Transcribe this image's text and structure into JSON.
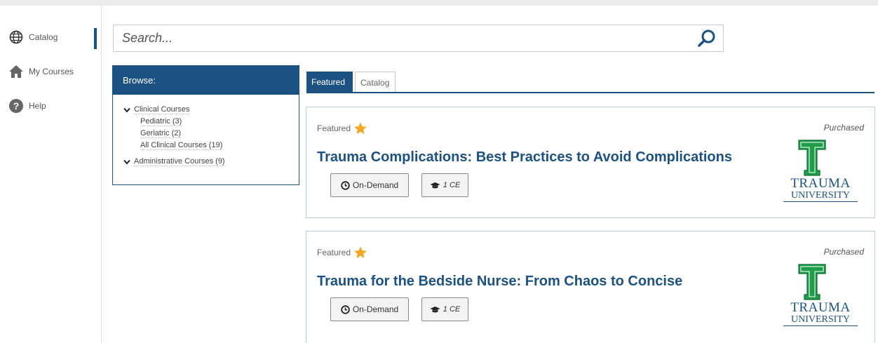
{
  "sidebar": {
    "items": [
      {
        "label": "Catalog",
        "icon": "globe-icon",
        "active": true
      },
      {
        "label": "My Courses",
        "icon": "home-icon",
        "active": false
      },
      {
        "label": "Help",
        "icon": "help-icon",
        "active": false
      }
    ]
  },
  "search": {
    "placeholder": "Search..."
  },
  "browse": {
    "header": "Browse:",
    "categories": [
      {
        "label": "Clinical Courses",
        "children": [
          "Pediatric (3)",
          "Geriatric (2)",
          "All Clinical Courses (19)"
        ]
      },
      {
        "label": "Administrative Courses (9)",
        "children": []
      }
    ]
  },
  "tabs": [
    {
      "label": "Featured",
      "active": true
    },
    {
      "label": "Catalog",
      "active": false
    }
  ],
  "courses": [
    {
      "featured_label": "Featured",
      "status": "Purchased",
      "title": "Trauma Complications: Best Practices to Avoid Complications",
      "format": "On-Demand",
      "credits": "1 CE",
      "logo_line1": "TRAUMA",
      "logo_line2": "UNIVERSITY"
    },
    {
      "featured_label": "Featured",
      "status": "Purchased",
      "title": "Trauma for the Bedside Nurse: From Chaos to Concise",
      "format": "On-Demand",
      "credits": "1 CE",
      "logo_line1": "TRAUMA",
      "logo_line2": "UNIVERSITY"
    }
  ],
  "colors": {
    "primary": "#1b5283",
    "logo_green": "#1e9e4a",
    "star": "#f5a623"
  }
}
